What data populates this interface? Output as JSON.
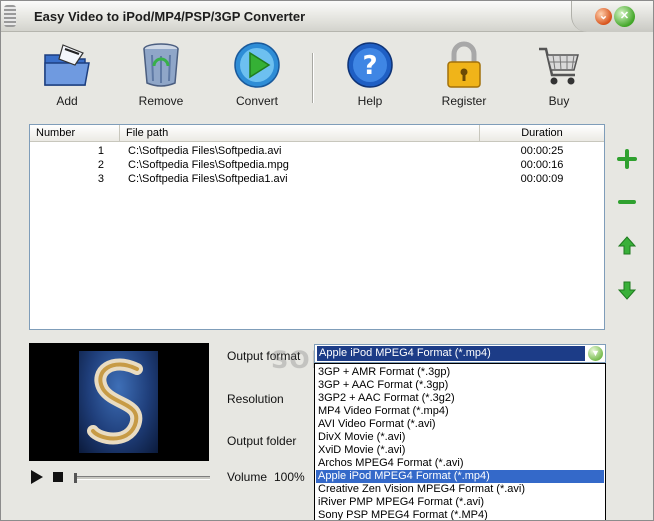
{
  "window": {
    "title": "Easy Video to iPod/MP4/PSP/3GP Converter"
  },
  "titlebar": {
    "minimize_glyph": "⌄",
    "close_glyph": "✕"
  },
  "toolbar": {
    "add_label": "Add",
    "remove_label": "Remove",
    "convert_label": "Convert",
    "help_label": "Help",
    "register_label": "Register",
    "buy_label": "Buy"
  },
  "filelist": {
    "columns": {
      "number": "Number",
      "path": "File path",
      "duration": "Duration"
    },
    "rows": [
      {
        "number": "1",
        "path": "C:\\Softpedia Files\\Softpedia.avi",
        "duration": "00:00:25"
      },
      {
        "number": "2",
        "path": "C:\\Softpedia Files\\Softpedia.mpg",
        "duration": "00:00:16"
      },
      {
        "number": "3",
        "path": "C:\\Softpedia Files\\Softpedia1.avi",
        "duration": "00:00:09"
      }
    ]
  },
  "side_buttons": [
    "plus-icon",
    "minus-icon",
    "arrow-up-icon",
    "arrow-down-icon"
  ],
  "settings": {
    "output_format_label": "Output format",
    "resolution_label": "Resolution",
    "output_folder_label": "Output folder",
    "volume_label": "Volume",
    "volume_value": "100%"
  },
  "output_format": {
    "selected": "Apple iPod MPEG4 Format (*.mp4)",
    "options": [
      "3GP + AMR Format (*.3gp)",
      "3GP + AAC Format (*.3gp)",
      "3GP2 + AAC Format (*.3g2)",
      "MP4 Video Format (*.mp4)",
      "AVI Video Format (*.avi)",
      "DivX Movie (*.avi)",
      "XviD Movie (*.avi)",
      "Archos MPEG4 Format (*.avi)",
      "Apple iPod MPEG4 Format (*.mp4)",
      "Creative Zen Vision MPEG4 Format (*.avi)",
      "iRiver PMP MPEG4 Format (*.avi)",
      "Sony PSP MPEG4 Format (*.MP4)"
    ],
    "highlighted_index": 8
  },
  "watermark": "SOFTPEDIA",
  "colors": {
    "accent": "#1c3c87",
    "selection": "#3469c9",
    "list_border": "#7f9db9"
  }
}
